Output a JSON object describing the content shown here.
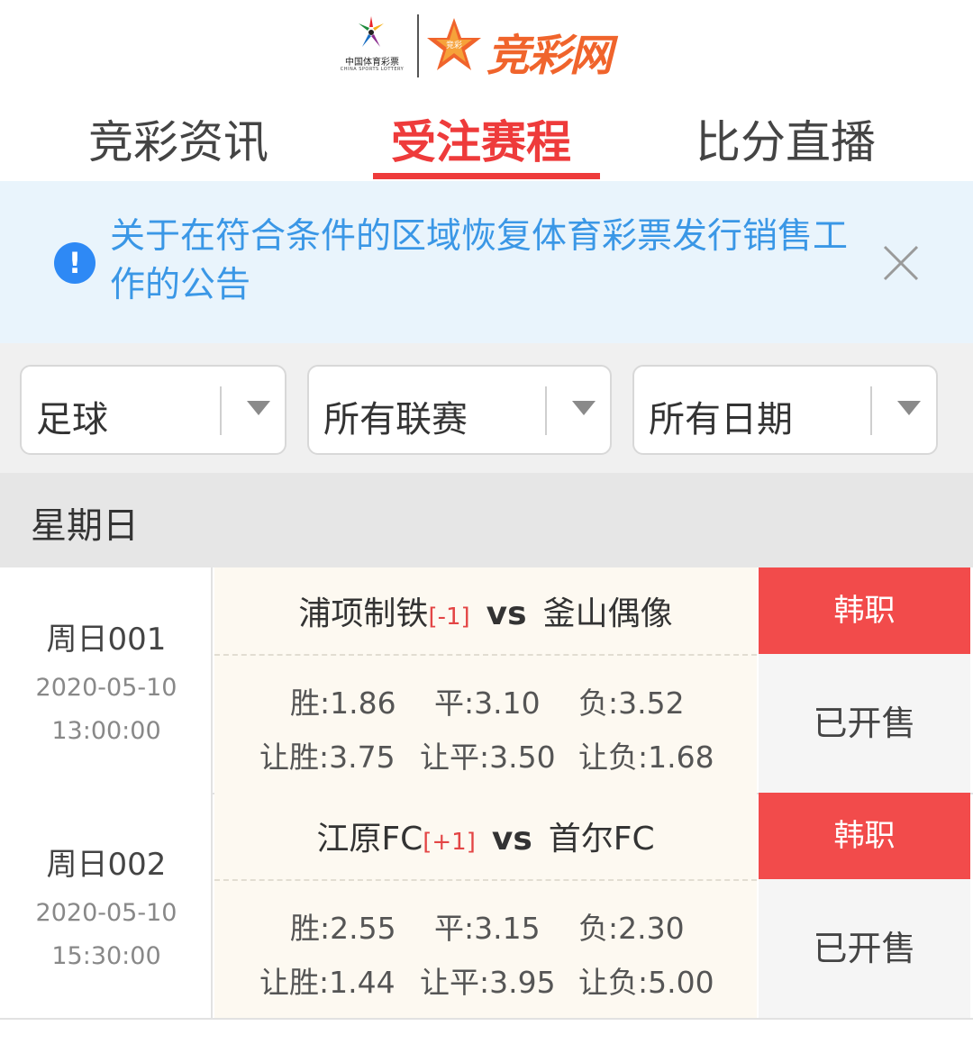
{
  "header": {
    "left_logo_text": "中国体育彩票",
    "left_logo_sub": "CHINA SPORTS LOTTERY",
    "right_logo_text": "竞彩网",
    "right_logo_badge": "竞彩",
    "icons": [
      "china-sports-lottery-logo-icon",
      "star-logo-icon"
    ]
  },
  "tabs": [
    {
      "label": "竞彩资讯",
      "active": false
    },
    {
      "label": "受注赛程",
      "active": true
    },
    {
      "label": "比分直播",
      "active": false
    }
  ],
  "notice": {
    "text": "关于在符合条件的区域恢复体育彩票发行销售工作的公告",
    "icon_glyph": "!",
    "icons": [
      "info-icon",
      "close-icon"
    ]
  },
  "filters": [
    {
      "label": "足球"
    },
    {
      "label": "所有联赛"
    },
    {
      "label": "所有日期"
    }
  ],
  "day_header": "星期日",
  "matches": [
    {
      "number": "周日001",
      "date": "2020-05-10",
      "time": "13:00:00",
      "home": "浦项制铁",
      "handicap": "[-1]",
      "vs": "vs",
      "away": "釜山偶像",
      "odds_win": "胜:1.86",
      "odds_draw": "平:3.10",
      "odds_lose": "负:3.52",
      "hcap_win": "让胜:3.75",
      "hcap_draw": "让平:3.50",
      "hcap_lose": "让负:1.68",
      "league": "韩职",
      "status": "已开售"
    },
    {
      "number": "周日002",
      "date": "2020-05-10",
      "time": "15:30:00",
      "home": "江原FC",
      "handicap": "[+1]",
      "vs": "vs",
      "away": "首尔FC",
      "odds_win": "胜:2.55",
      "odds_draw": "平:3.15",
      "odds_lose": "负:2.30",
      "hcap_win": "让胜:1.44",
      "hcap_draw": "让平:3.95",
      "hcap_lose": "让负:5.00",
      "league": "韩职",
      "status": "已开售"
    }
  ],
  "colors": {
    "accent": "#ee3b3b",
    "league_badge": "#f24b4b",
    "notice_bg": "#e9f4fc",
    "notice_text": "#3a97e6",
    "info_icon": "#2e89f5",
    "brand_orange": "#f0642c"
  }
}
